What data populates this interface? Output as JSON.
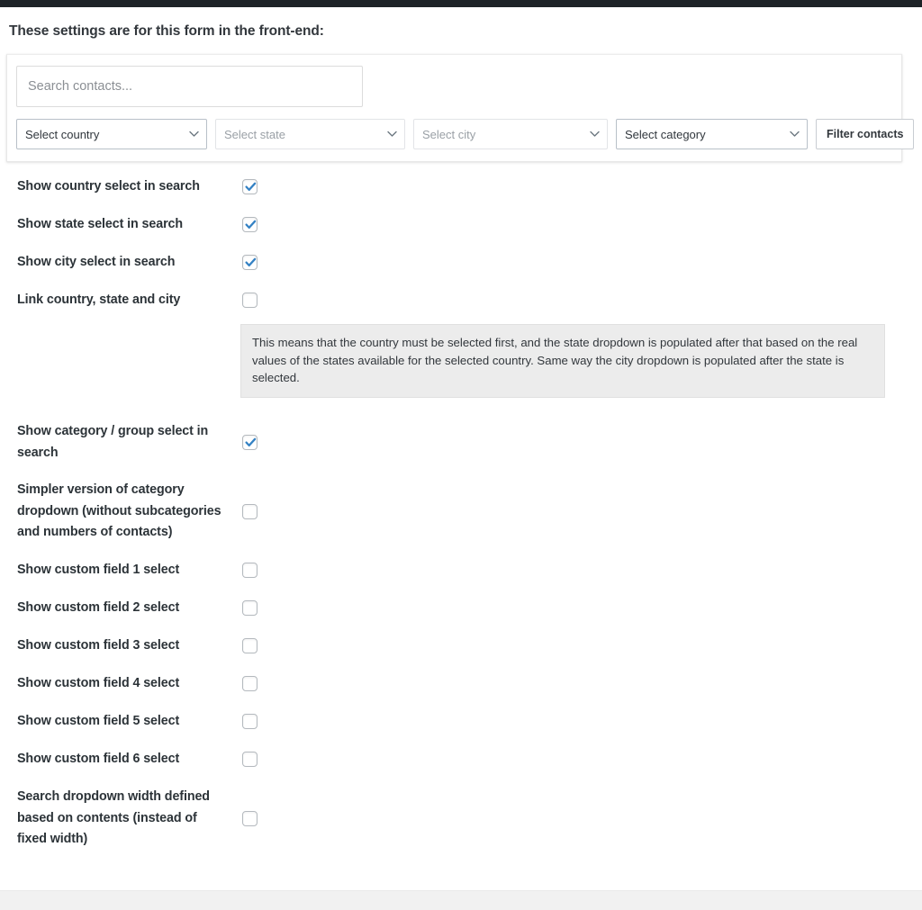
{
  "heading": "These settings are for this form in the front-end:",
  "preview": {
    "search": {
      "placeholder": "Search contacts...",
      "value": ""
    },
    "selects": [
      {
        "name": "country",
        "label": "Select country",
        "style": "strong"
      },
      {
        "name": "state",
        "label": "Select state",
        "style": "muted"
      },
      {
        "name": "city",
        "label": "Select city",
        "style": "muted"
      },
      {
        "name": "category",
        "label": "Select category",
        "style": "strong"
      }
    ],
    "filter_button": "Filter contacts"
  },
  "settings": [
    {
      "label": "Show country select in search",
      "checked": true
    },
    {
      "label": "Show state select in search",
      "checked": true
    },
    {
      "label": "Show city select in search",
      "checked": true
    },
    {
      "label": "Link country, state and city",
      "checked": false
    }
  ],
  "link_note": "This means that the country must be selected first, and the state dropdown is populated after that based on the real values of the states available for the selected country. Same way the city dropdown is populated after the state is selected.",
  "settings2": [
    {
      "label": "Show category / group select in search",
      "checked": true
    },
    {
      "label": "Simpler version of category dropdown (without subcategories and numbers of contacts)",
      "checked": false
    },
    {
      "label": "Show custom field 1 select",
      "checked": false
    },
    {
      "label": "Show custom field 2 select",
      "checked": false
    },
    {
      "label": "Show custom field 3 select",
      "checked": false
    },
    {
      "label": "Show custom field 4 select",
      "checked": false
    },
    {
      "label": "Show custom field 5 select",
      "checked": false
    },
    {
      "label": "Show custom field 6 select",
      "checked": false
    },
    {
      "label": "Search dropdown width defined based on contents (instead of fixed width)",
      "checked": false
    }
  ],
  "colors": {
    "admin_bar": "#1d2327",
    "checkbox_accent": "#3582c4",
    "label_text": "#2c3338",
    "note_background": "#ececec"
  },
  "icons": {
    "chevron": "chevron-down-icon",
    "check": "checkmark-icon"
  }
}
